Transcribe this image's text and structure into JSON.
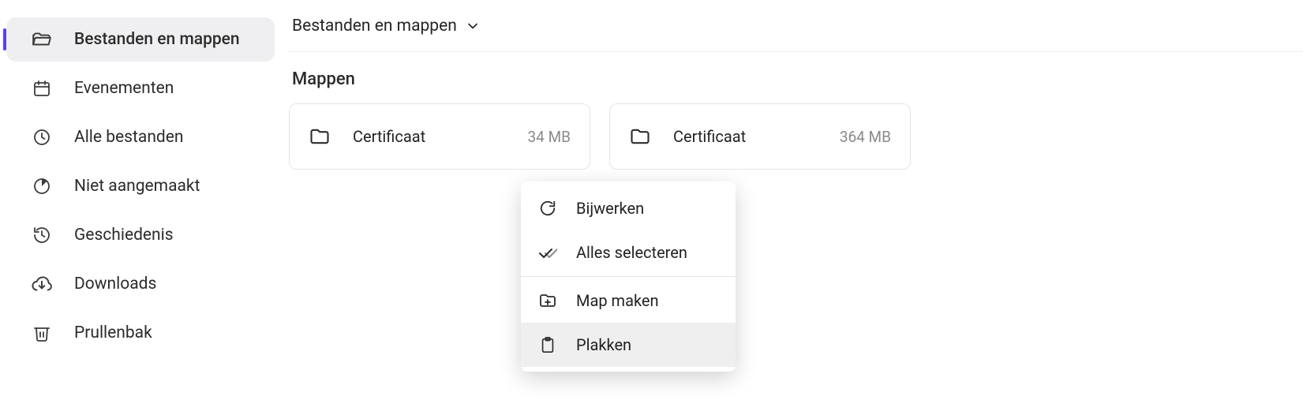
{
  "sidebar": {
    "items": [
      {
        "label": "Bestanden en mappen",
        "active": true
      },
      {
        "label": "Evenementen"
      },
      {
        "label": "Alle bestanden"
      },
      {
        "label": "Niet aangemaakt"
      },
      {
        "label": "Geschiedenis"
      },
      {
        "label": "Downloads"
      },
      {
        "label": "Prullenbak"
      }
    ]
  },
  "breadcrumb": {
    "current": "Bestanden en mappen"
  },
  "section": {
    "folders_heading": "Mappen"
  },
  "folders": [
    {
      "name": "Certificaat",
      "size": "34 MB"
    },
    {
      "name": "Certificaat",
      "size": "364 MB"
    }
  ],
  "context_menu": {
    "refresh": "Bijwerken",
    "select_all": "Alles selecteren",
    "create_folder": "Map maken",
    "paste": "Plakken"
  }
}
